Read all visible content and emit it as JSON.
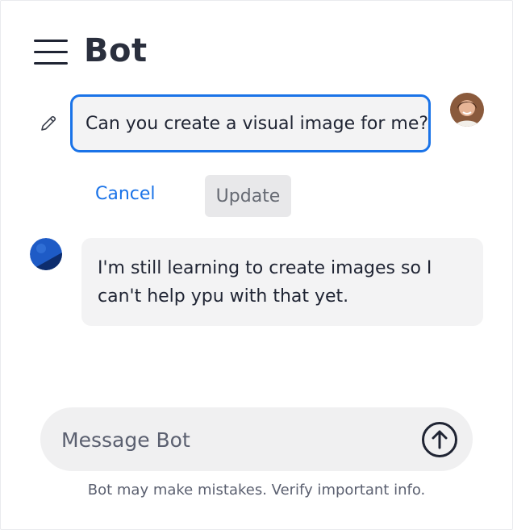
{
  "header": {
    "title": "Bot",
    "menu_icon": "hamburger-menu-icon"
  },
  "edit_message": {
    "icon": "pencil-icon",
    "text": "Can you create a visual image for me?",
    "cancel_label": "Cancel",
    "update_label": "Update"
  },
  "user": {
    "avatar": "user-avatar-photo"
  },
  "bot_message": {
    "avatar": "bot-avatar-logo",
    "text": "I'm still learning to create images so I can't help ypu with that yet."
  },
  "composer": {
    "placeholder": "Message Bot",
    "send_icon": "arrow-up-circle-icon"
  },
  "footer": {
    "disclaimer": "Bot may make mistakes. Verify important info."
  },
  "colors": {
    "accent": "#1a73e8",
    "text": "#1f2433",
    "bubble": "#f3f3f4"
  }
}
